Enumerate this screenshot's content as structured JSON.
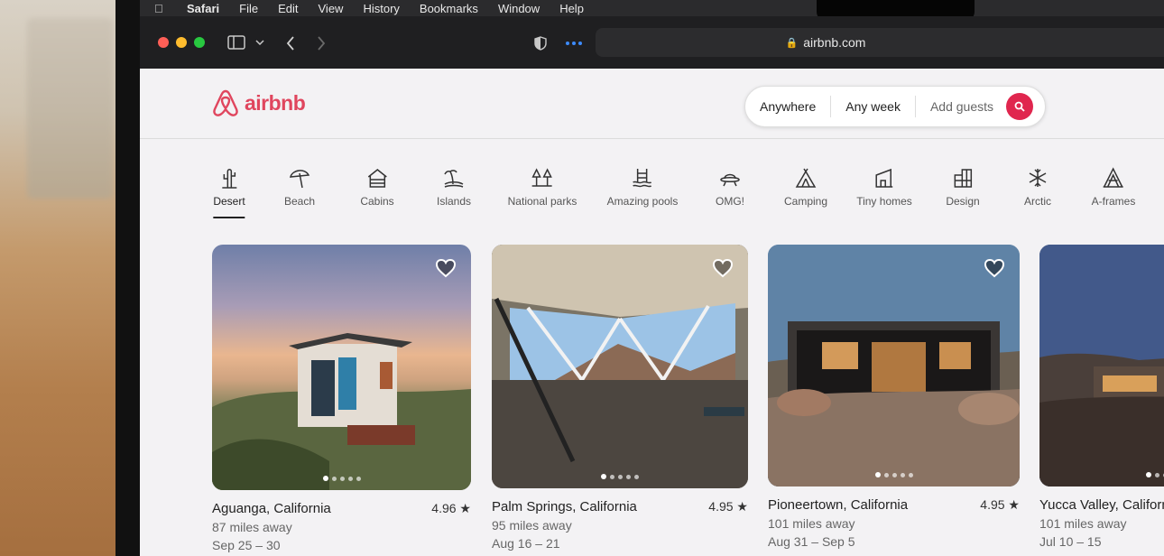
{
  "menubar": {
    "app": "Safari",
    "items": [
      "File",
      "Edit",
      "View",
      "History",
      "Bookmarks",
      "Window",
      "Help"
    ]
  },
  "browser": {
    "url": "airbnb.com"
  },
  "header": {
    "logo_text": "airbnb",
    "search": {
      "where": "Anywhere",
      "when": "Any week",
      "guests": "Add guests"
    }
  },
  "categories": [
    {
      "label": "Desert",
      "icon": "cactus-icon",
      "active": true
    },
    {
      "label": "Beach",
      "icon": "umbrella-icon"
    },
    {
      "label": "Cabins",
      "icon": "cabin-icon"
    },
    {
      "label": "Islands",
      "icon": "island-icon"
    },
    {
      "label": "National parks",
      "icon": "park-icon"
    },
    {
      "label": "Amazing pools",
      "icon": "pool-icon"
    },
    {
      "label": "OMG!",
      "icon": "ufo-icon"
    },
    {
      "label": "Camping",
      "icon": "tent-icon"
    },
    {
      "label": "Tiny homes",
      "icon": "tiny-home-icon"
    },
    {
      "label": "Design",
      "icon": "design-icon"
    },
    {
      "label": "Arctic",
      "icon": "snowflake-icon"
    },
    {
      "label": "A-frames",
      "icon": "a-frame-icon"
    }
  ],
  "listings": [
    {
      "place": "Aguanga, California",
      "rating": "4.96 ★",
      "distance": "87 miles away",
      "dates": "Sep 25 – 30"
    },
    {
      "place": "Palm Springs, California",
      "rating": "4.95 ★",
      "distance": "95 miles away",
      "dates": "Aug 16 – 21"
    },
    {
      "place": "Pioneertown, California",
      "rating": "4.95 ★",
      "distance": "101 miles away",
      "dates": "Aug 31 – Sep 5"
    },
    {
      "place": "Yucca Valley, Californ",
      "rating": "",
      "distance": "101 miles away",
      "dates": "Jul 10 – 15"
    }
  ],
  "colors": {
    "brand": "#e0465e",
    "search_button": "#e0264e"
  }
}
